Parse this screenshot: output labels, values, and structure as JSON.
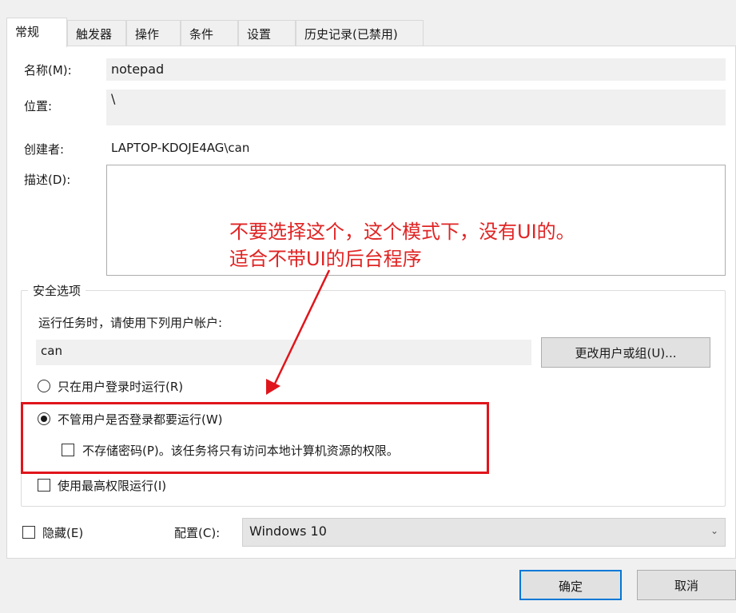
{
  "tabs": [
    "常规",
    "触发器",
    "操作",
    "条件",
    "设置",
    "历史记录(已禁用)"
  ],
  "general": {
    "name_label": "名称(M):",
    "name_value": "notepad",
    "location_label": "位置:",
    "location_value": "\\",
    "author_label": "创建者:",
    "author_value": "LAPTOP-KDOJE4AG\\can",
    "description_label": "描述(D):"
  },
  "security": {
    "title": "安全选项",
    "run_as_label": "运行任务时，请使用下列用户帐户:",
    "user_value": "can",
    "change_user_button": "更改用户或组(U)...",
    "radio_logged_on": "只在用户登录时运行(R)",
    "radio_whether_logged": "不管用户是否登录都要运行(W)",
    "check_no_store_password": "不存储密码(P)。该任务将只有访问本地计算机资源的权限。",
    "check_highest_privileges": "使用最高权限运行(I)"
  },
  "bottom": {
    "hidden_label": "隐藏(E)",
    "configure_label": "配置(C):",
    "configure_value": "Windows 10"
  },
  "buttons": {
    "ok": "确定",
    "cancel": "取消"
  },
  "annotation": {
    "line1": "不要选择这个，这个模式下，没有UI的。",
    "line2": "适合不带UI的后台程序"
  },
  "colors": {
    "annotation_red": "#e0151b",
    "focus_blue": "#0078d7"
  }
}
